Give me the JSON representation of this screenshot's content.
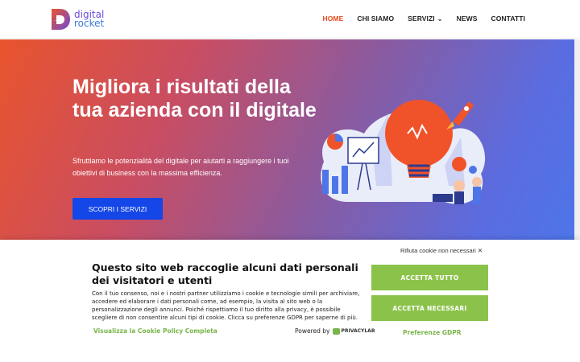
{
  "header": {
    "logo": {
      "line1": "digital",
      "line2": "rocket"
    },
    "nav": [
      {
        "label": "HOME",
        "active": true
      },
      {
        "label": "CHI SIAMO",
        "active": false
      },
      {
        "label": "SERVIZI",
        "active": false,
        "dropdown": true
      },
      {
        "label": "NEWS",
        "active": false
      },
      {
        "label": "CONTATTI",
        "active": false
      }
    ]
  },
  "hero": {
    "title": "Migliora i risultati della tua azienda con il digitale",
    "subtitle": "Sfruttiamo le potenzialità del digitale per aiutarti a raggiungere i tuoi obiettivi di business con la massima efficienza.",
    "cta": "SCOPRI I SERVIZI",
    "illustration_icon": "lightbulb-rocket-illustration"
  },
  "cookie": {
    "reject_label": "Rifiuta cookie non necessari ✕",
    "title": "Questo sito web raccoglie alcuni dati personali dei visitatori e utenti",
    "text": "Con il tuo consenso, noi e i nostri partner utilizziamo i cookie e tecnologie simili per archiviare, accedere ed elaborare i dati personali come, ad esempio, la visita al sito web o la personalizzazione degli annunci. Poiché rispettiamo il tuo diritto alla privacy, è possibile scegliere di non consentire alcuni tipi di cookie. Clicca su preferenze GDPR per saperne di più.",
    "policy_link": "Visualizza la Cookie Policy Completa",
    "powered_by": "Powered by",
    "powered_brand": "PRIVACYLAB",
    "accept_all": "ACCETTA TUTTO",
    "accept_necessary": "ACCETTA NECESSARI",
    "preferences": "Preferenze GDPR"
  },
  "colors": {
    "accent": "#e8481c",
    "cta_blue": "#1446e8",
    "cookie_green": "#8bc34a"
  }
}
